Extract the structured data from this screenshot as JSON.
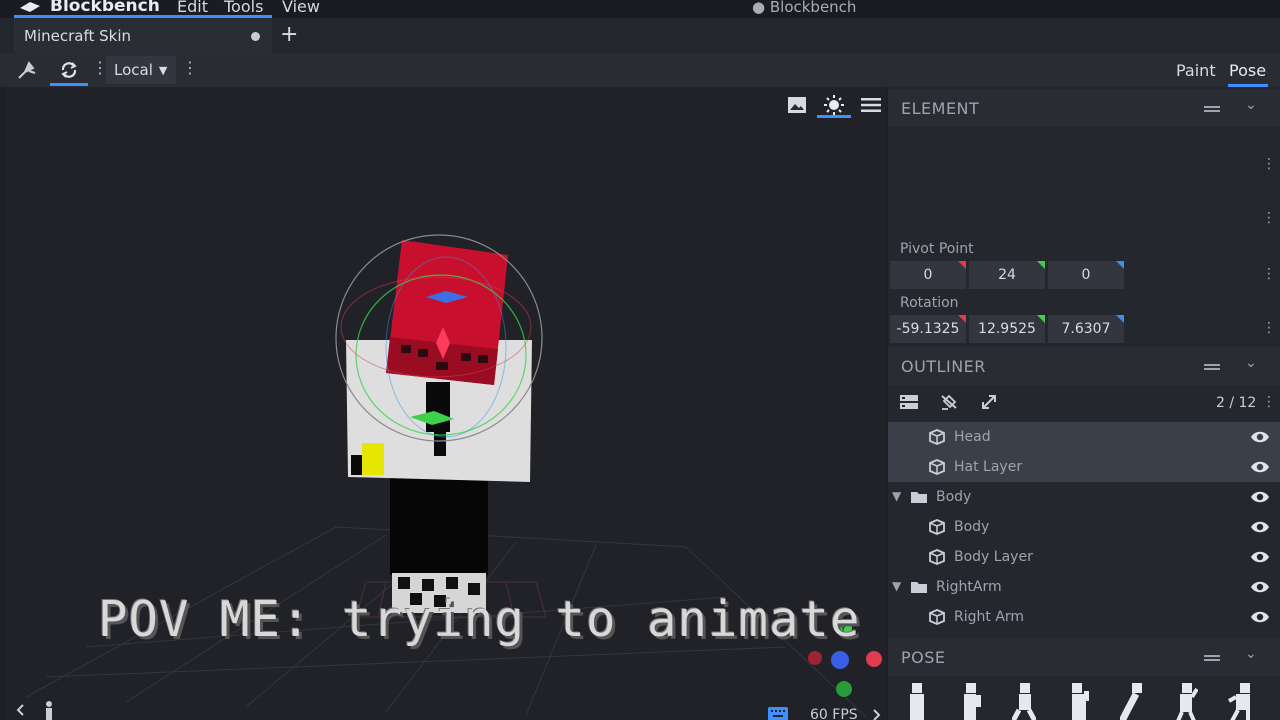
{
  "app": {
    "name": "Blockbench",
    "window_title": "● Blockbench",
    "menu": [
      "Edit",
      "Tools",
      "View"
    ]
  },
  "tabs": [
    {
      "label": "Minecraft Skin",
      "unsaved": true
    }
  ],
  "toolbar": {
    "space_select": "Local",
    "modes": {
      "paint": "Paint",
      "pose": "Pose",
      "active": "Pose"
    }
  },
  "viewport": {
    "caption": "POV ME: trying to animate",
    "fps": "60 FPS",
    "icons": [
      "image-icon",
      "sun-icon",
      "menu-icon"
    ]
  },
  "element_panel": {
    "title": "ELEMENT",
    "pivot_point": {
      "label": "Pivot Point",
      "values": [
        "0",
        "24",
        "0"
      ]
    },
    "rotation": {
      "label": "Rotation",
      "values": [
        "-59.1325",
        "12.9525",
        "7.6307"
      ]
    }
  },
  "outliner": {
    "title": "OUTLINER",
    "count": "2 / 12",
    "rows": [
      {
        "label": "Head",
        "type": "cube",
        "indent": 1,
        "selected": true
      },
      {
        "label": "Hat Layer",
        "type": "cube",
        "indent": 1,
        "selected": true
      },
      {
        "label": "Body",
        "type": "group",
        "indent": 0,
        "selected": false
      },
      {
        "label": "Body",
        "type": "cube",
        "indent": 1,
        "selected": false
      },
      {
        "label": "Body Layer",
        "type": "cube",
        "indent": 1,
        "selected": false
      },
      {
        "label": "RightArm",
        "type": "group",
        "indent": 0,
        "selected": false
      },
      {
        "label": "Right Arm",
        "type": "cube",
        "indent": 1,
        "selected": false
      }
    ]
  },
  "pose_panel": {
    "title": "POSE"
  },
  "colors": {
    "accent": "#3e90ff",
    "axis_x": "#e23b4f",
    "axis_y": "#3bd24a",
    "axis_z": "#3a8fe6"
  }
}
